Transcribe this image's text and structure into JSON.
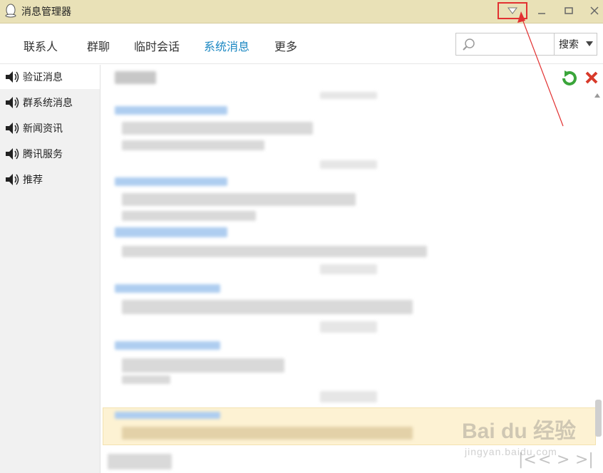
{
  "window": {
    "title": "消息管理器"
  },
  "tabs": [
    {
      "label": "联系人",
      "active": false
    },
    {
      "label": "群聊",
      "active": false
    },
    {
      "label": "临时会话",
      "active": false
    },
    {
      "label": "系统消息",
      "active": true
    },
    {
      "label": "更多",
      "active": false
    }
  ],
  "search": {
    "placeholder": "",
    "value": "",
    "button_label": "搜索"
  },
  "sidebar": {
    "items": [
      {
        "label": "验证消息",
        "icon": "speaker-icon",
        "active": true
      },
      {
        "label": "群系统消息",
        "icon": "speaker-icon",
        "active": false
      },
      {
        "label": "新闻资讯",
        "icon": "speaker-icon",
        "active": false
      },
      {
        "label": "腾讯服务",
        "icon": "speaker-icon",
        "active": false
      },
      {
        "label": "推荐",
        "icon": "speaker-icon",
        "active": false
      }
    ]
  },
  "colors": {
    "titlebar": "#e9e1b7",
    "active_tab": "#1a87c2",
    "annotation": "#e23131",
    "highlight": "#fdf2d3"
  },
  "watermark": {
    "brand": "Bai du 经验",
    "sub": "jingyan.baidu.com"
  }
}
